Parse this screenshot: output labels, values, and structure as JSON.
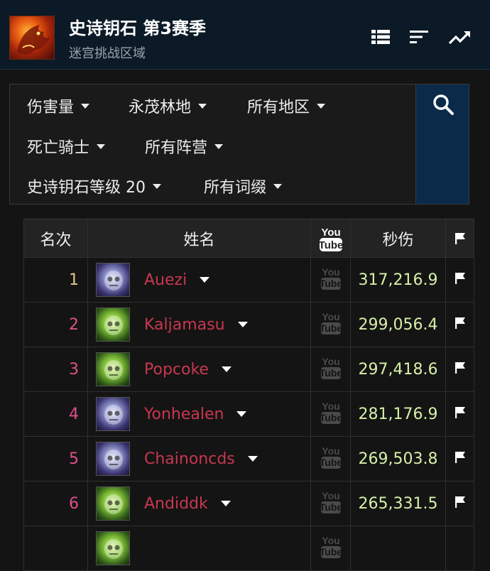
{
  "header": {
    "title": "史诗钥石 第3赛季",
    "subtitle": "迷宫挑战区域",
    "logo_icon": "dragon-logo",
    "icons": [
      "list-icon",
      "sort-icon",
      "trend-icon"
    ]
  },
  "filters": {
    "metric": "伤害量",
    "zone": "永茂林地",
    "region": "所有地区",
    "class": "死亡骑士",
    "faction": "所有阵营",
    "keystone": "史诗钥石等级 20",
    "affixes": "所有词缀"
  },
  "table": {
    "headers": {
      "rank": "名次",
      "name": "姓名",
      "youtube": "You Tube",
      "dps": "秒伤"
    },
    "rows": [
      {
        "rank": "1",
        "name": "Auezi",
        "dps": "317,216.9",
        "avatar": "purple",
        "rank_color": "#e7c98c"
      },
      {
        "rank": "2",
        "name": "Kaljamasu",
        "dps": "299,056.4",
        "avatar": "green",
        "rank_color": "#e0508a"
      },
      {
        "rank": "3",
        "name": "Popcoke",
        "dps": "297,418.6",
        "avatar": "green",
        "rank_color": "#e0508a"
      },
      {
        "rank": "4",
        "name": "Yonhealen",
        "dps": "281,176.9",
        "avatar": "purple",
        "rank_color": "#e0508a"
      },
      {
        "rank": "5",
        "name": "Chainoncds",
        "dps": "269,503.8",
        "avatar": "purple",
        "rank_color": "#e0508a"
      },
      {
        "rank": "6",
        "name": "Andiddk",
        "dps": "265,331.5",
        "avatar": "green",
        "rank_color": "#e0508a"
      },
      {
        "rank": "",
        "name": "",
        "dps": "",
        "avatar": "green",
        "rank_color": "#e0508a"
      }
    ]
  },
  "colors": {
    "header_bg": "#0b1a26",
    "search_bg": "#0b2a4a",
    "player_name": "#c8374f",
    "dps": "#d6f0a8"
  }
}
